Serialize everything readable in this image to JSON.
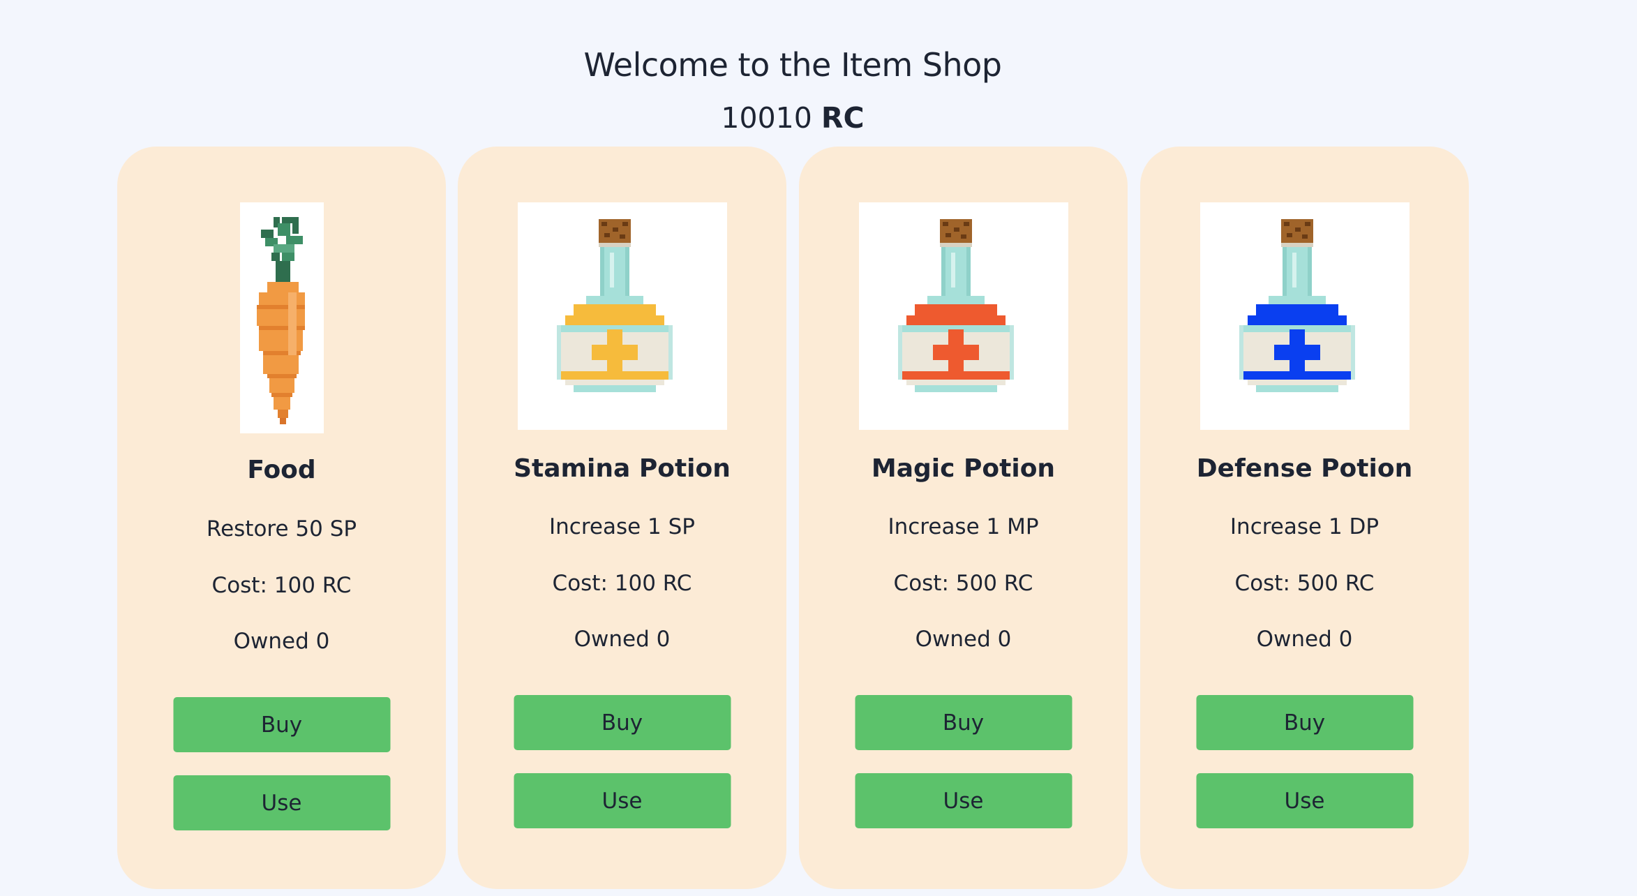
{
  "header": {
    "title": "Welcome to the Item Shop",
    "balance_amount": "10010",
    "balance_unit": "RC"
  },
  "colors": {
    "page_background": "#f3f6fd",
    "card_background": "#fcebd6",
    "button_green": "#5cc26b",
    "stamina_accent": "#f6bb3c",
    "magic_accent": "#ee5a2f",
    "defense_accent": "#0a3ff0"
  },
  "items": [
    {
      "name": "Food",
      "description": "Restore 50 SP",
      "cost": "Cost: 100 RC",
      "owned": "Owned 0",
      "buy_label": "Buy",
      "use_label": "Use",
      "icon": "carrot-icon"
    },
    {
      "name": "Stamina Potion",
      "description": "Increase 1 SP",
      "cost": "Cost: 100 RC",
      "owned": "Owned 0",
      "buy_label": "Buy",
      "use_label": "Use",
      "icon": "yellow-potion-icon"
    },
    {
      "name": "Magic Potion",
      "description": "Increase 1 MP",
      "cost": "Cost: 500 RC",
      "owned": "Owned 0",
      "buy_label": "Buy",
      "use_label": "Use",
      "icon": "red-potion-icon"
    },
    {
      "name": "Defense Potion",
      "description": "Increase 1 DP",
      "cost": "Cost: 500 RC",
      "owned": "Owned 0",
      "buy_label": "Buy",
      "use_label": "Use",
      "icon": "blue-potion-icon"
    }
  ]
}
